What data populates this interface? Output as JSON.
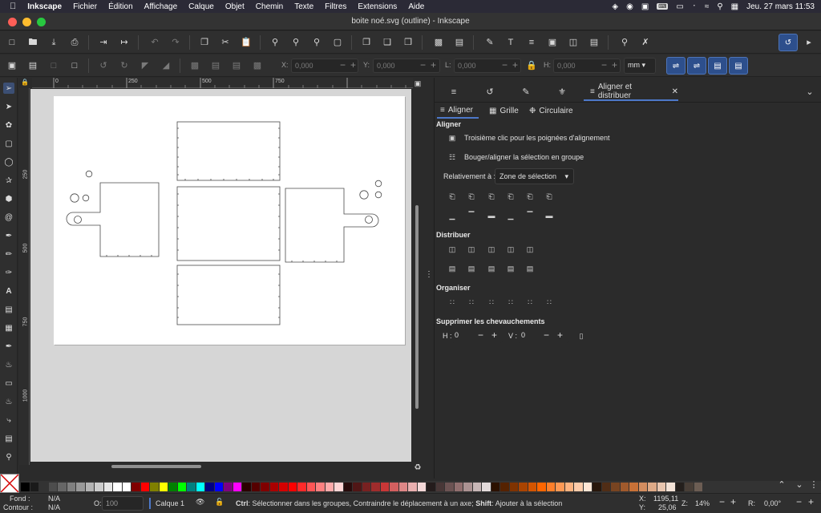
{
  "menubar": {
    "app": "Inkscape",
    "items": [
      "Fichier",
      "Édition",
      "Affichage",
      "Calque",
      "Objet",
      "Chemin",
      "Texte",
      "Filtres",
      "Extensions",
      "Aide"
    ],
    "datetime": "Jeu. 27 mars  11:53"
  },
  "window": {
    "title": "boite noé.svg (outline) - Inkscape"
  },
  "selector_toolbar": {
    "x_label": "X:",
    "x_value": "0,000",
    "y_label": "Y:",
    "y_value": "0,000",
    "w_label": "L:",
    "w_value": "0,000",
    "h_label": "H:",
    "h_value": "0,000",
    "unit": "mm"
  },
  "rulers": {
    "h": [
      "0",
      "250",
      "500",
      "750"
    ],
    "v": [
      "250",
      "500",
      "750",
      "1000"
    ]
  },
  "dock": {
    "active_tab": "Aligner et distribuer",
    "subtabs": [
      "Aligner",
      "Grille",
      "Circulaire"
    ],
    "align_heading": "Aligner",
    "opt1": "Troisième clic pour les poignées d'alignement",
    "opt2": "Bouger/aligner la sélection en groupe",
    "relative_label": "Relativement à :",
    "relative_value": "Zone de sélection",
    "distribute_heading": "Distribuer",
    "organize_heading": "Organiser",
    "overlap_heading": "Supprimer les chevauchements",
    "h_label": "H :",
    "h_value": "0",
    "v_label": "V :",
    "v_value": "0"
  },
  "statusbar": {
    "fill_label": "Fond :",
    "fill_value": "N/A",
    "stroke_label": "Contour :",
    "stroke_value": "N/A",
    "opacity_label": "O:",
    "opacity_value": "100",
    "layer": "Calque 1",
    "message_ctrl": "Ctrl",
    "message_a": ": Sélectionner dans les groupes, Contraindre le déplacement à un axe; ",
    "message_shift": "Shift",
    "message_b": ": Ajouter à la sélection",
    "cursor_x_label": "X:",
    "cursor_x": "1195,11",
    "cursor_y_label": "Y:",
    "cursor_y": "25,06",
    "zoom_label": "Z:",
    "zoom": "14%",
    "rotate_label": "R:",
    "rotate": "0,00°"
  },
  "palette_colors": [
    "#000000",
    "#1a1a1a",
    "#333333",
    "#4d4d4d",
    "#666666",
    "#808080",
    "#999999",
    "#b3b3b3",
    "#cccccc",
    "#e6e6e6",
    "#ffffff",
    "#ffffff",
    "#800000",
    "#ff0000",
    "#808000",
    "#ffff00",
    "#008000",
    "#00ff00",
    "#008080",
    "#00ffff",
    "#000080",
    "#0000ff",
    "#800080",
    "#ff00ff",
    "#2b0000",
    "#550000",
    "#800000",
    "#aa0000",
    "#d40000",
    "#ff0000",
    "#ff2a2a",
    "#ff5555",
    "#ff8080",
    "#ffaaaa",
    "#ffd5d5",
    "#280b0b",
    "#501616",
    "#782121",
    "#a02c2c",
    "#c83737",
    "#d35f5f",
    "#de8787",
    "#e9afaf",
    "#f4d7d7",
    "#241c1c",
    "#483737",
    "#6c5353",
    "#916f6f",
    "#ac9393",
    "#c8b7b7",
    "#e3dbdb",
    "#2b1100",
    "#552200",
    "#803300",
    "#aa4400",
    "#d45500",
    "#ff6600",
    "#ff7f2a",
    "#ff9955",
    "#ffb380",
    "#ffccaa",
    "#ffe6d5",
    "#28170b",
    "#502d16",
    "#784421",
    "#a05a2c",
    "#c87137",
    "#d38d5f",
    "#deaa87",
    "#e9c6af",
    "#f4e3d7",
    "#241f1c",
    "#483e37",
    "#6c5d53"
  ]
}
